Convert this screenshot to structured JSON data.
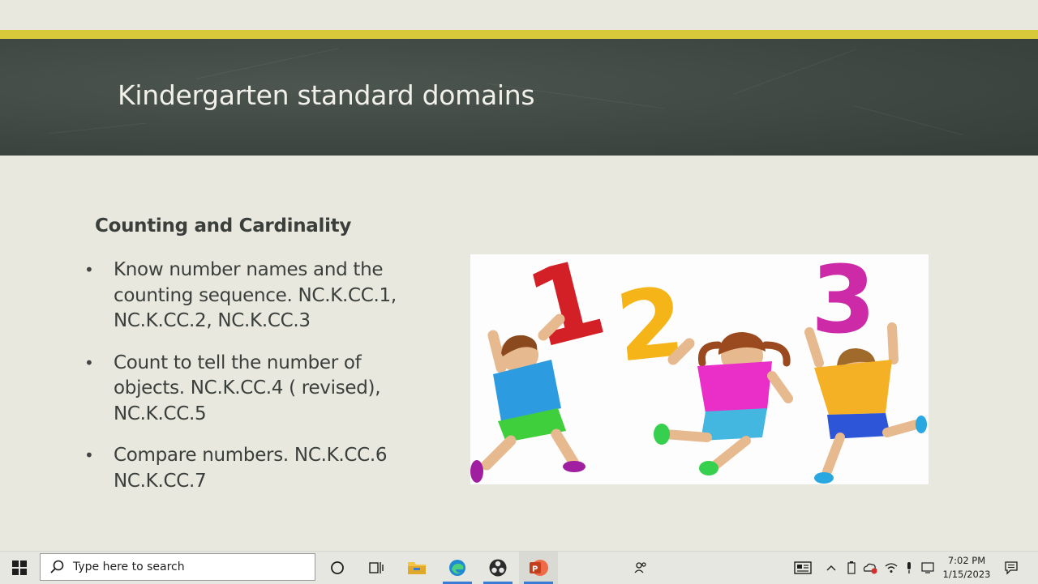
{
  "slide": {
    "title": "Kindergarten standard domains",
    "section_heading": "Counting  and Cardinality",
    "bullets": [
      "Know number names and the counting sequence. NC.K.CC.1, NC.K.CC.2, NC.K.CC.3",
      "Count to tell the number of objects. NC.K.CC.4 ( revised), NC.K.CC.5",
      "Compare numbers. NC.K.CC.6 NC.K.CC.7"
    ],
    "picture": {
      "numerals": [
        "1",
        "2",
        "3"
      ],
      "colors": {
        "one": "#d31f26",
        "two": "#f5b417",
        "three": "#cc2aa6"
      }
    },
    "colors": {
      "accent_bar": "#d8c93a",
      "title_band": "#3f4843",
      "background": "#e9e8de"
    }
  },
  "taskbar": {
    "start_icon": "windows-logo-icon",
    "search_placeholder": "Type here to search",
    "pinned_apps": [
      {
        "name": "task-view-icon"
      },
      {
        "name": "timeline-icon"
      },
      {
        "name": "file-explorer-icon"
      },
      {
        "name": "edge-icon"
      },
      {
        "name": "obs-icon"
      },
      {
        "name": "powerpoint-icon"
      }
    ],
    "tray_icons": [
      "people-icon",
      "news-icon",
      "chevron-up-icon",
      "battery-icon",
      "onedrive-icon",
      "wifi-icon",
      "microphone-icon",
      "display-icon"
    ],
    "time": "7:02 PM",
    "date": "1/15/2023",
    "notification_icon": "notification-icon"
  }
}
